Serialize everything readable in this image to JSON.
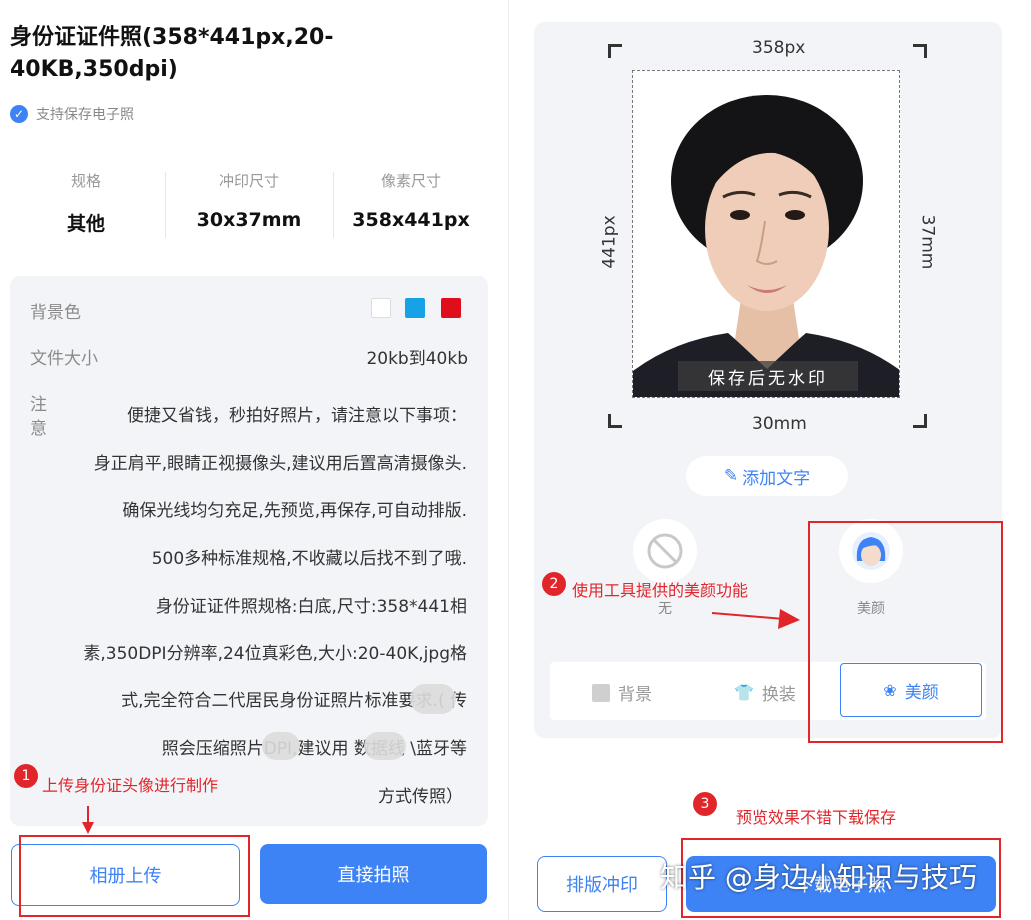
{
  "title": "身份证证件照(358*441px,20-40KB,350dpi)",
  "verified_text": "支持保存电子照",
  "specs": [
    {
      "label": "规格",
      "value": "其他"
    },
    {
      "label": "冲印尺寸",
      "value": "30x37mm"
    },
    {
      "label": "像素尺寸",
      "value": "358x441px"
    }
  ],
  "info": {
    "bg_label": "背景色",
    "bg_colors": [
      "#ffffff",
      "#16a2e6",
      "#e00d1a"
    ],
    "size_label": "文件大小",
    "size_value": "20kb到40kb",
    "note_label_1": "注",
    "note_label_2": "意",
    "note_lines": [
      "便捷又省钱，秒拍好照片，请注意以下事项：",
      "身正肩平,眼睛正视摄像头,建议用后置高清摄像头.",
      "确保光线均匀充足,先预览,再保存,可自动排版.",
      "500多种标准规格,不收藏以后找不到了哦.",
      "身份证证件照规格:白底,尺寸:358*441相",
      "素,350DPI分辨率,24位真彩色,大小:20-40K,jpg格",
      "式,完全符合二代居民身份证照片标准要求.(     传",
      "照会压缩照片DPI,建议用     数据线     \\蓝牙等",
      "方式传照）"
    ]
  },
  "buttons": {
    "album": "相册上传",
    "camera": "直接拍照",
    "print": "排版冲印",
    "download": "下载电子照"
  },
  "preview": {
    "width_px": "358px",
    "height_px": "441px",
    "width_mm": "30mm",
    "height_mm": "37mm",
    "watermark": "保存后无水印",
    "add_text": "添加文字"
  },
  "options": [
    {
      "label": "无",
      "icon": "ban-icon"
    },
    {
      "label": "美颜",
      "icon": "avatar-icon"
    }
  ],
  "tabs": [
    {
      "label": "背景",
      "icon": "background-icon"
    },
    {
      "label": "换装",
      "icon": "shirt-icon"
    },
    {
      "label": "美颜",
      "icon": "beauty-icon"
    }
  ],
  "annotations": [
    {
      "num": "1",
      "text": "上传身份证头像进行制作"
    },
    {
      "num": "2",
      "text": "使用工具提供的美颜功能"
    },
    {
      "num": "3",
      "text": "预览效果不错下载保存"
    }
  ],
  "colors": {
    "accent": "#3e83f5",
    "annotation": "#e0262b",
    "panel_bg": "#f3f4f8"
  },
  "watermark_site": "知乎 @身边小知识与技巧"
}
